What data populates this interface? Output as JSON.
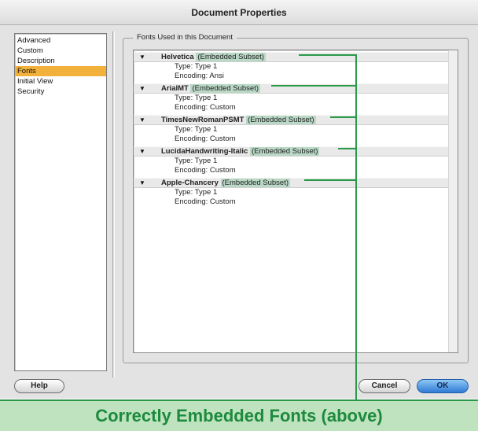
{
  "window": {
    "title": "Document Properties"
  },
  "sidebar": {
    "items": [
      {
        "label": "Advanced",
        "selected": false
      },
      {
        "label": "Custom",
        "selected": false
      },
      {
        "label": "Description",
        "selected": false
      },
      {
        "label": "Fonts",
        "selected": true
      },
      {
        "label": "Initial View",
        "selected": false
      },
      {
        "label": "Security",
        "selected": false
      }
    ]
  },
  "fonts_group": {
    "title": "Fonts Used in this Document",
    "fonts": [
      {
        "name": "Helvetica",
        "subset": "(Embedded Subset)",
        "type": "Type: Type 1",
        "encoding": "Encoding: Ansi"
      },
      {
        "name": "ArialMT",
        "subset": "(Embedded Subset)",
        "type": "Type: Type 1",
        "encoding": "Encoding: Custom"
      },
      {
        "name": "TimesNewRomanPSMT",
        "subset": "(Embedded Subset)",
        "type": "Type: Type 1",
        "encoding": "Encoding: Custom"
      },
      {
        "name": "LucidaHandwriting-Italic",
        "subset": "(Embedded Subset)",
        "type": "Type: Type 1",
        "encoding": "Encoding: Custom"
      },
      {
        "name": "Apple-Chancery",
        "subset": "(Embedded Subset)",
        "type": "Type: Type 1",
        "encoding": "Encoding: Custom"
      }
    ]
  },
  "buttons": {
    "help": "Help",
    "cancel": "Cancel",
    "ok": "OK"
  },
  "banner": {
    "text": "Correctly Embedded Fonts (above)"
  },
  "colors": {
    "accent_selected": "#f2b13a",
    "callout_green": "#2a9a4a",
    "subset_highlight": "#b9d8c5"
  }
}
